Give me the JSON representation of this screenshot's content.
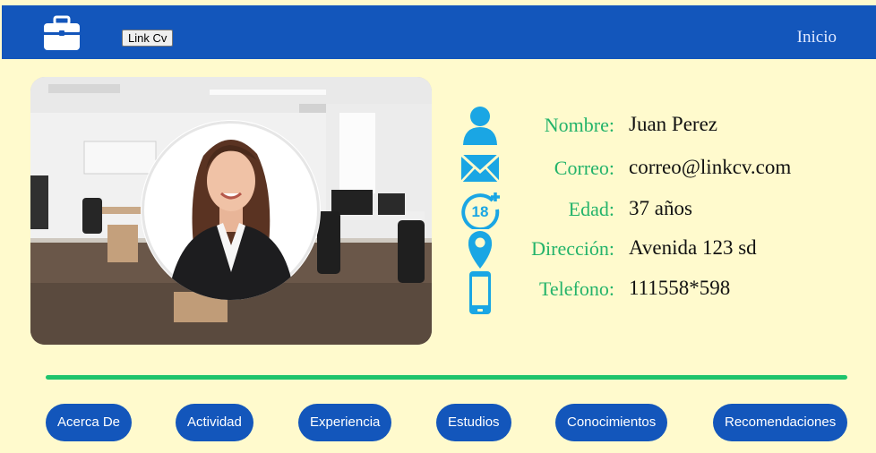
{
  "navbar": {
    "logo_icon": "briefcase-icon",
    "button_label": "Link Cv",
    "nav_link": "Inicio",
    "background": "#1356bb"
  },
  "profile": {
    "photo_description_icon": "office-photo",
    "avatar_icon": "person-portrait",
    "fields": [
      {
        "icon": "user-icon",
        "label": "Nombre:",
        "value": "Juan Perez"
      },
      {
        "icon": "envelope-icon",
        "label": "Correo:",
        "value": "correo@linkcv.com"
      },
      {
        "icon": "age-18-plus-icon",
        "label": "Edad:",
        "value": "37 años"
      },
      {
        "icon": "location-pin-icon",
        "label": "Dirección:",
        "value": "Avenida 123 sd"
      },
      {
        "icon": "mobile-phone-icon",
        "label": "Telefono:",
        "value": "111558*598"
      }
    ],
    "label_color": "#23b36a",
    "icon_color": "#1aa6e4"
  },
  "tabs": [
    {
      "label": "Acerca De"
    },
    {
      "label": "Actividad"
    },
    {
      "label": "Experiencia"
    },
    {
      "label": "Estudios"
    },
    {
      "label": "Conocimientos"
    },
    {
      "label": "Recomendaciones"
    }
  ],
  "colors": {
    "page_background": "#fffacd",
    "divider": "#1ec46c",
    "tab_button": "#1356bb"
  }
}
